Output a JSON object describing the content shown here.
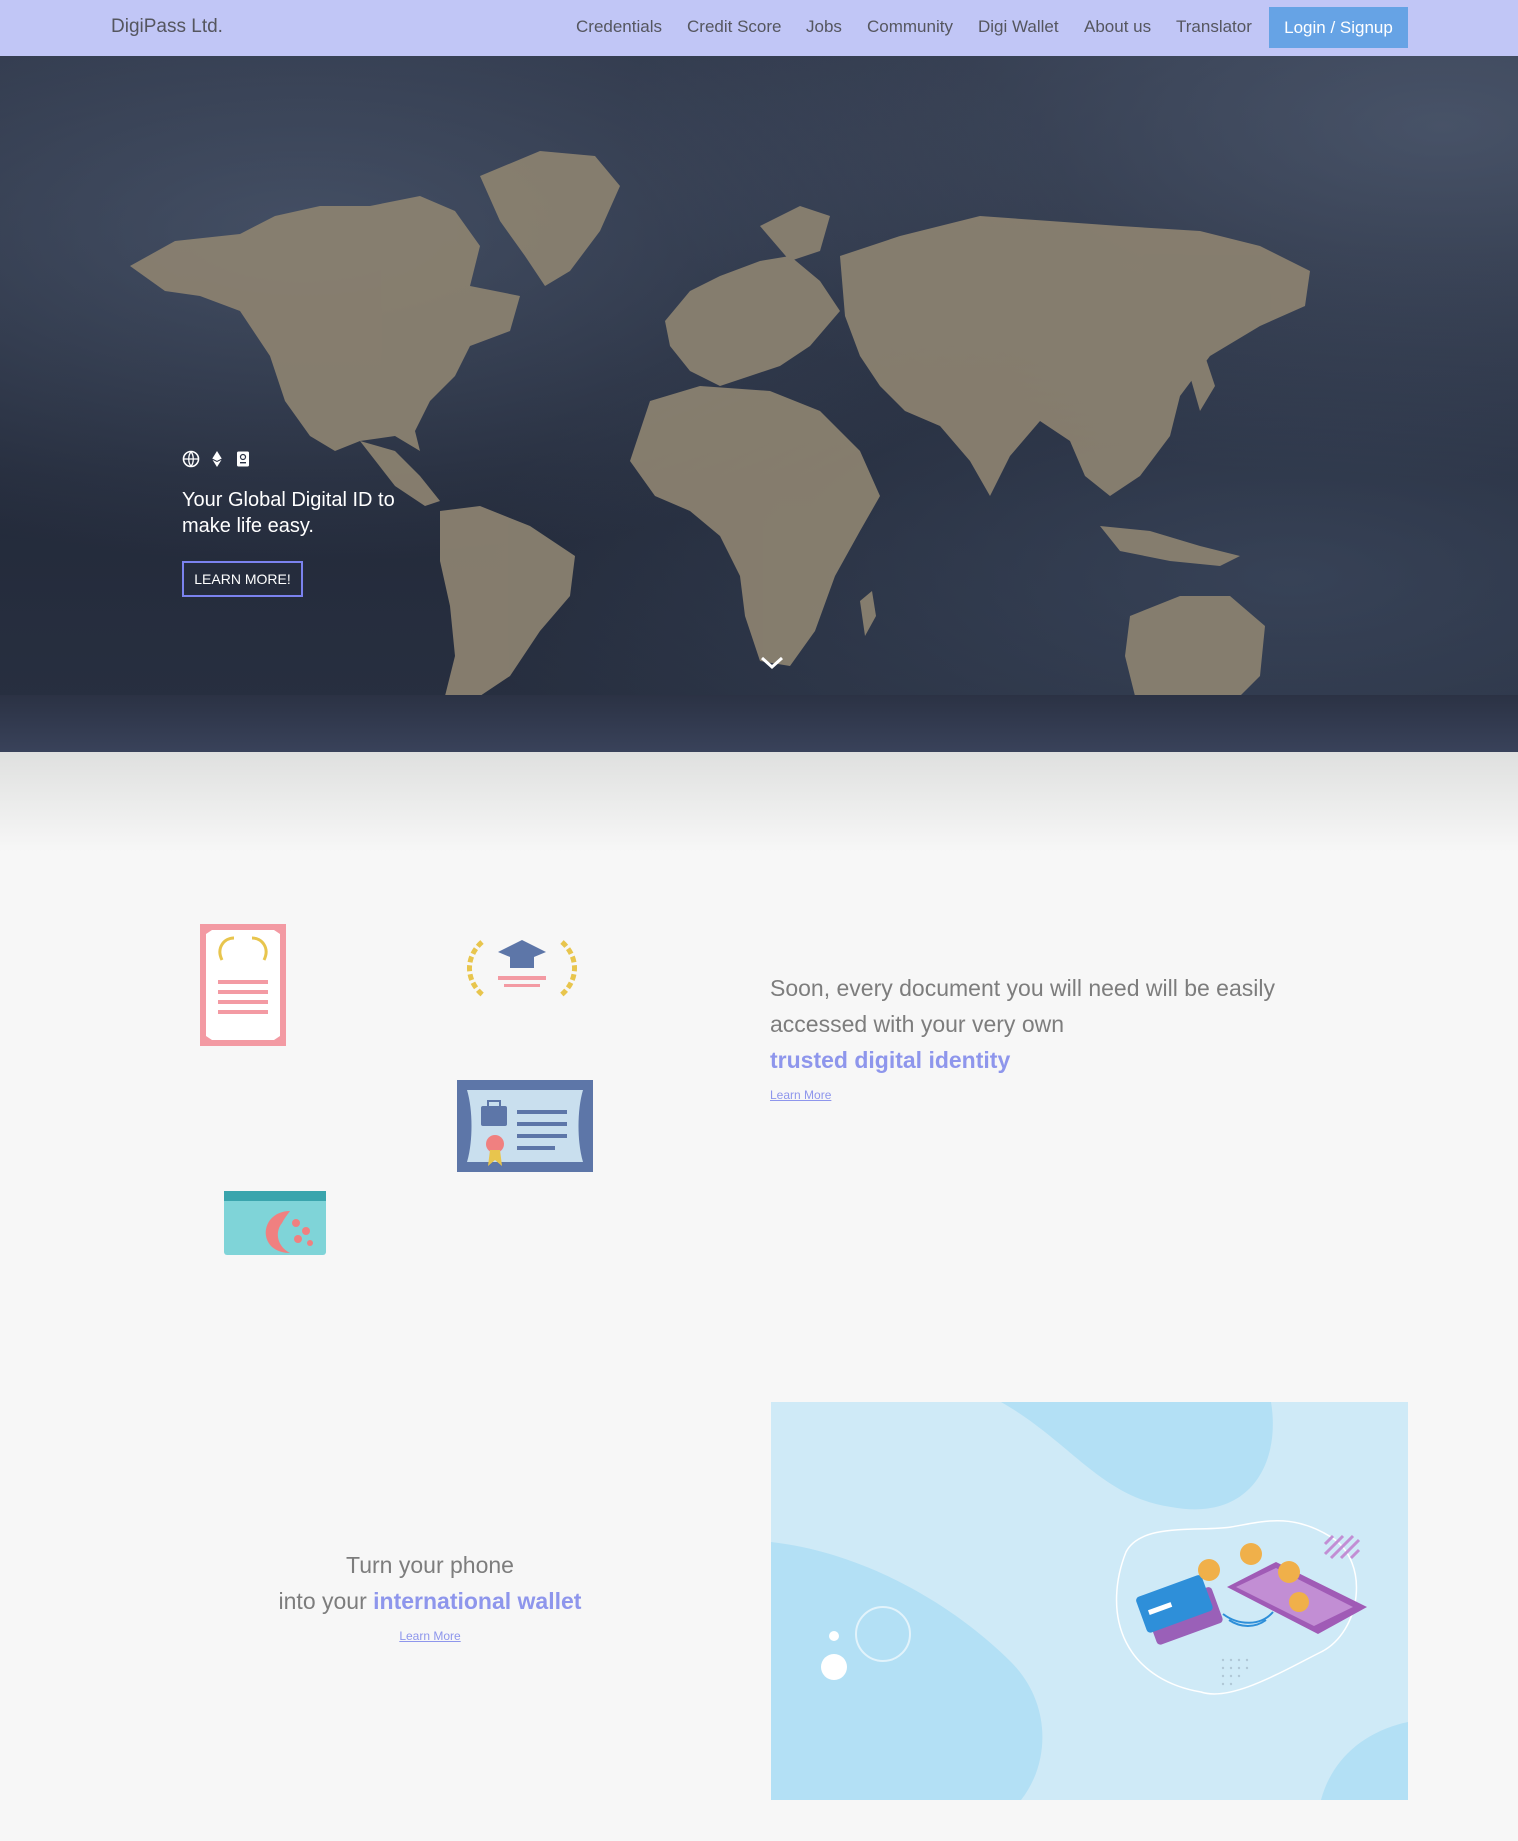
{
  "nav": {
    "brand": "DigiPass Ltd.",
    "links": [
      "Credentials",
      "Credit Score",
      "Jobs",
      "Community",
      "Digi Wallet",
      "About us",
      "Translator"
    ],
    "login_label": "Login / Signup"
  },
  "hero": {
    "tagline": "Your Global Digital ID to make life easy.",
    "cta_label": "LEARN MORE!",
    "icons": [
      "globe-icon",
      "ethereum-icon",
      "passport-icon"
    ]
  },
  "documents": {
    "line1": "Soon, every document you will need will be easily",
    "line2": "accessed with your very own",
    "highlight": "trusted digital identity",
    "link": "Learn More",
    "icons": [
      "certificate-icon",
      "graduation-laurel-icon",
      "id-card-icon",
      "passport-card-icon"
    ]
  },
  "wallet": {
    "line1": "Turn your phone",
    "line2_prefix": "into your ",
    "highlight": "international wallet",
    "link": "Learn More"
  },
  "colors": {
    "nav_bg": "#c1c6f6",
    "accent": "#8e96ec",
    "login_bg": "#66a3e5",
    "map_land": "#8a8170"
  }
}
